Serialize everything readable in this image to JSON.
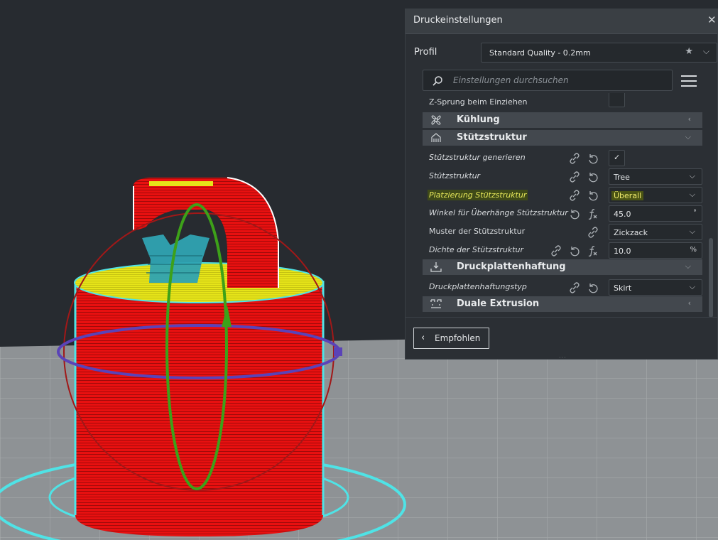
{
  "panel": {
    "title": "Druckeinstellungen",
    "close_glyph": "✕",
    "profile_label": "Profil",
    "profile_value": "Standard Quality - 0.2mm",
    "search_placeholder": "Einstellungen durchsuchen"
  },
  "rows": {
    "z_hop": {
      "label": "Z-Sprung beim Einziehen"
    },
    "cooling": {
      "label": "Kühlung"
    },
    "support": {
      "label": "Stützstruktur"
    },
    "support_generate": {
      "label": "Stützstruktur generieren",
      "checked": true,
      "check_glyph": "✓"
    },
    "support_structure": {
      "label": "Stützstruktur",
      "value": "Tree"
    },
    "support_placement": {
      "label": "Platzierung Stützstruktur",
      "value": "Überall"
    },
    "support_angle": {
      "label": "Winkel für Überhänge Stützstruktur",
      "value": "45.0",
      "unit": "°"
    },
    "support_pattern": {
      "label": "Muster der Stützstruktur",
      "value": "Zickzack"
    },
    "support_density": {
      "label": "Dichte der Stützstruktur",
      "value": "10.0",
      "unit": "%"
    },
    "adhesion": {
      "label": "Druckplattenhaftung"
    },
    "adhesion_type": {
      "label": "Druckplattenhaftungstyp",
      "value": "Skirt"
    },
    "dual_extrusion": {
      "label": "Duale Extrusion"
    }
  },
  "footer": {
    "recommended_label": "Empfohlen"
  },
  "colors": {
    "background": "#272b30",
    "build_plate": "#8e9295",
    "model_red": "#e81010",
    "model_top": "#e6e419",
    "support": "#2fa3b2",
    "highlight": "#e7e85a",
    "gizmo_red": "#a11818",
    "gizmo_green": "#3da119",
    "gizmo_blue": "#5a43b8"
  }
}
